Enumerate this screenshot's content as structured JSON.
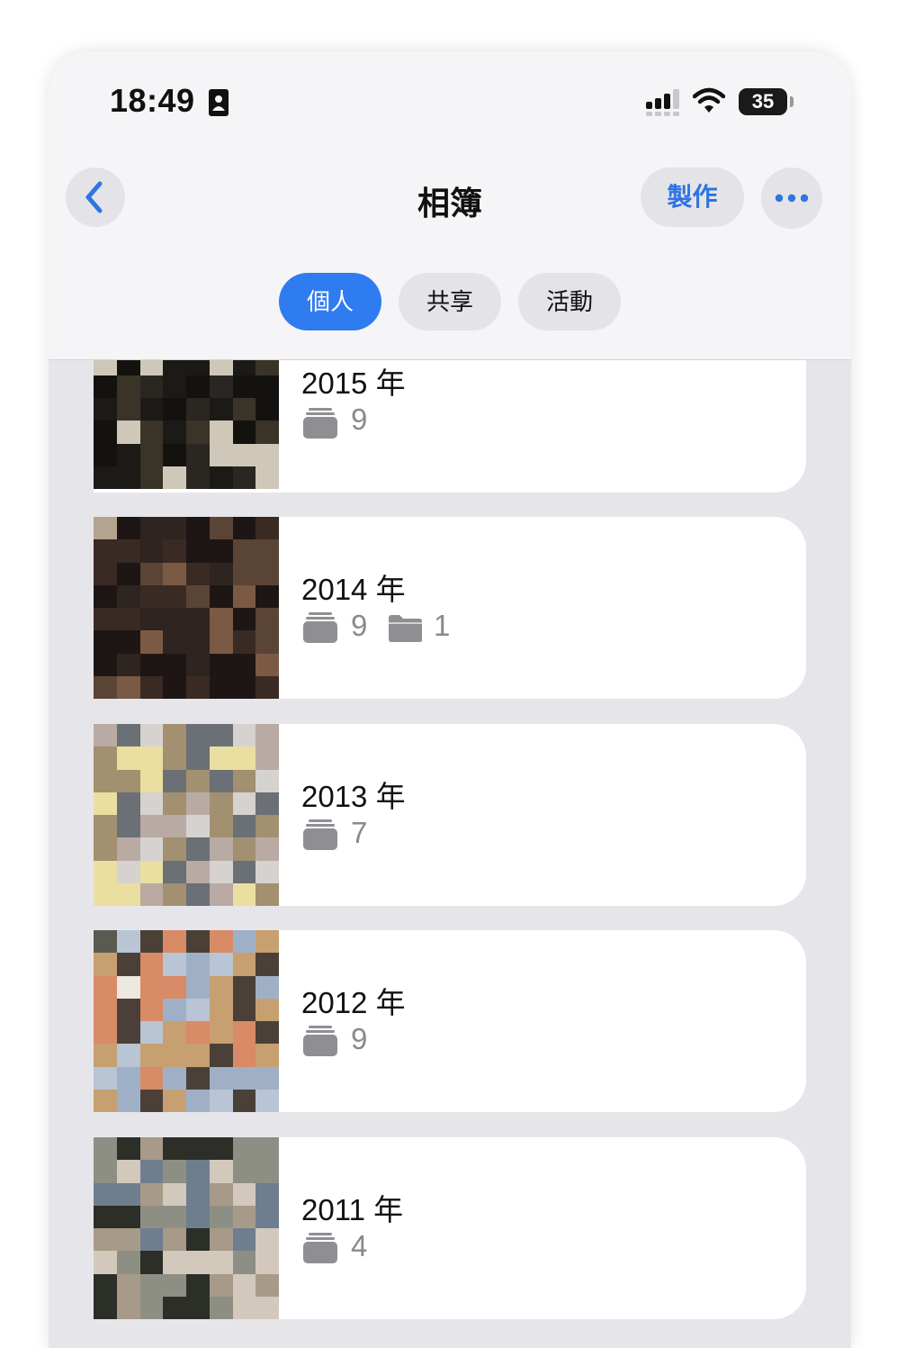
{
  "status": {
    "time": "18:49",
    "battery": "35"
  },
  "nav": {
    "title": "相簿",
    "create_label": "製作"
  },
  "tabs": [
    {
      "label": "個人",
      "active": true
    },
    {
      "label": "共享",
      "active": false
    },
    {
      "label": "活動",
      "active": false
    }
  ],
  "albums": [
    {
      "title": "2015 年",
      "album_count": "9"
    },
    {
      "title": "2014 年",
      "album_count": "9",
      "folder_count": "1"
    },
    {
      "title": "2013 年",
      "album_count": "7"
    },
    {
      "title": "2012 年",
      "album_count": "9"
    },
    {
      "title": "2011 年",
      "album_count": "4"
    }
  ],
  "colors": {
    "accent": "#2f7cf0",
    "link": "#2f74e0",
    "secondary_text": "#8a8a8e",
    "background": "#e6e6ea"
  },
  "icons": [
    "id-card-icon",
    "signal-icon",
    "wifi-icon",
    "battery-icon",
    "back-chevron-icon",
    "more-dots-icon",
    "album-stack-icon",
    "folder-icon"
  ]
}
